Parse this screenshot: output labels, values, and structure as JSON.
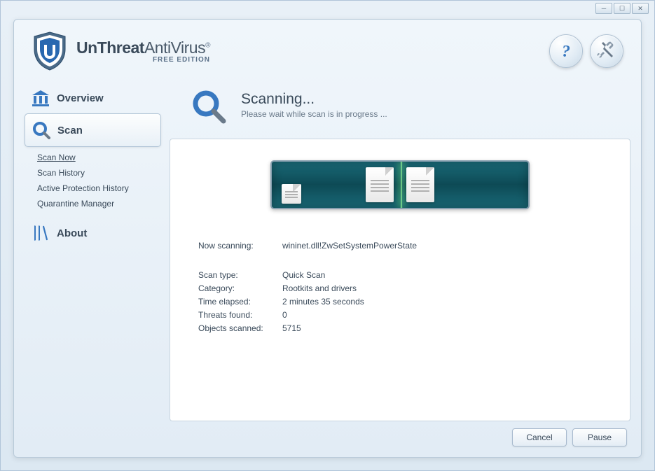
{
  "brand": {
    "part1": "UnThreat",
    "part2": "AntiVirus",
    "edition": "FREE EDITION"
  },
  "sidebar": {
    "overview": "Overview",
    "scan": "Scan",
    "about": "About",
    "scan_subitems": [
      "Scan Now",
      "Scan History",
      "Active Protection History",
      "Quarantine Manager"
    ]
  },
  "content": {
    "title": "Scanning...",
    "subtitle": "Please wait while scan is in progress ..."
  },
  "details": {
    "now_scanning_label": "Now scanning:",
    "now_scanning_value": "wininet.dll!ZwSetSystemPowerState",
    "scan_type_label": "Scan type:",
    "scan_type_value": "Quick Scan",
    "category_label": "Category:",
    "category_value": "Rootkits and drivers",
    "time_elapsed_label": "Time elapsed:",
    "time_elapsed_value": "2 minutes  35 seconds",
    "threats_label": "Threats found:",
    "threats_value": "0",
    "objects_label": "Objects scanned:",
    "objects_value": "5715"
  },
  "buttons": {
    "cancel": "Cancel",
    "pause": "Pause"
  }
}
